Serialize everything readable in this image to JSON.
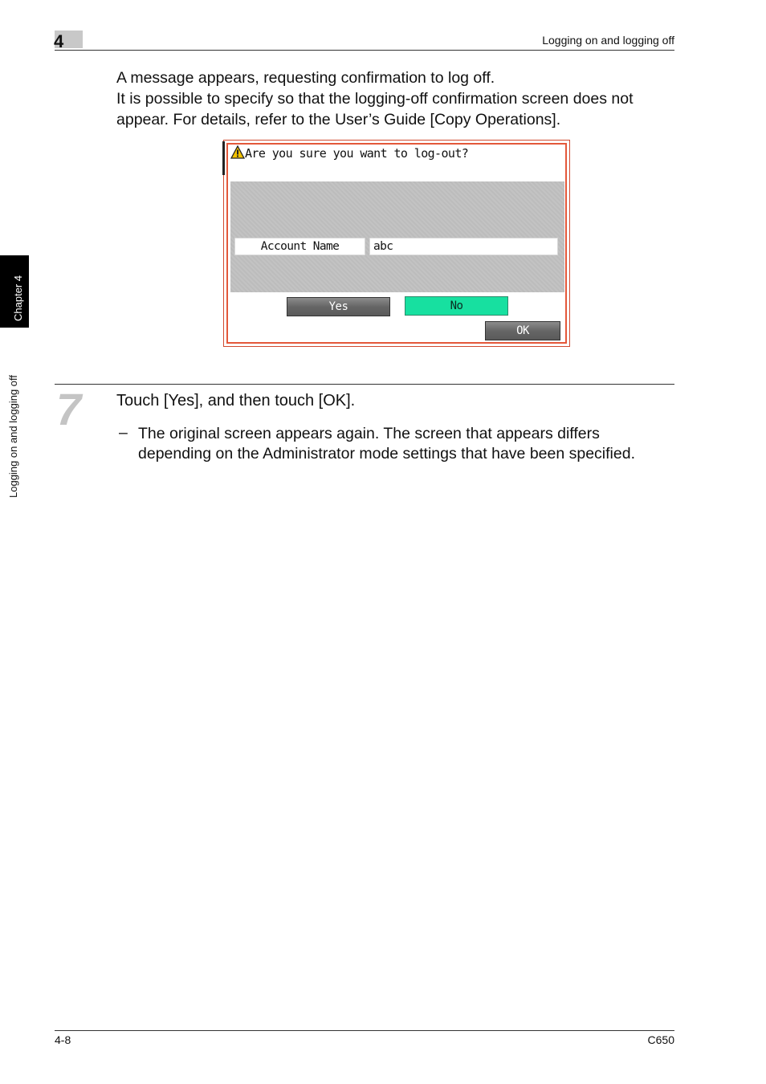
{
  "header": {
    "chapter_number": "4",
    "section_title": "Logging on and logging off"
  },
  "side": {
    "chapter_tab": "Chapter 4",
    "section_label": "Logging on and logging off"
  },
  "intro": {
    "line1": "A message appears, requesting confirmation to log off.",
    "line2": "It is possible to specify so that the logging-off confirmation screen does not",
    "line3": "appear. For details, refer to the User’s Guide [Copy Operations]."
  },
  "dialog": {
    "message": "Are you sure you want to log-out?",
    "field_label": "Account Name",
    "field_value": "abc",
    "yes_label": "Yes",
    "no_label": "No",
    "ok_label": "OK",
    "colors": {
      "frame": "#e4583a",
      "no_button": "#17e0a0",
      "warning": "#f2c200"
    }
  },
  "step": {
    "number": "7",
    "instruction": "Touch [Yes], and then touch [OK].",
    "bullet_dash": "–",
    "bullet_line1": "The original screen appears again. The screen that appears differs",
    "bullet_line2": "depending on the Administrator mode settings that have been specified."
  },
  "footer": {
    "page": "4-8",
    "model": "C650"
  }
}
